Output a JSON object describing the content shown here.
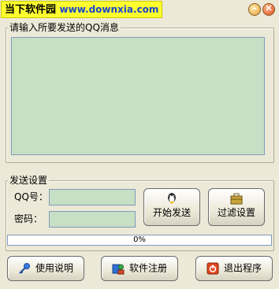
{
  "window": {
    "title_app": "当下软件园",
    "title_url": "www.downxia.com",
    "minimize_glyph": "–",
    "close_glyph": "×"
  },
  "message": {
    "legend": "请输入所要发送的QQ消息",
    "value": ""
  },
  "send_settings": {
    "legend": "发送设置",
    "qq_label": "QQ号：",
    "qq_value": "",
    "password_label": "密码：",
    "password_value": "",
    "start_button": "开始发送",
    "filter_button": "过滤设置"
  },
  "progress": {
    "percent": 0,
    "text": "0%"
  },
  "footer": {
    "help_button": "使用说明",
    "register_button": "软件注册",
    "exit_button": "退出程序"
  },
  "colors": {
    "field_bg": "#c7dfc5",
    "window_bg": "#ece9d8",
    "title_logo_bg": "#ffff2e"
  }
}
